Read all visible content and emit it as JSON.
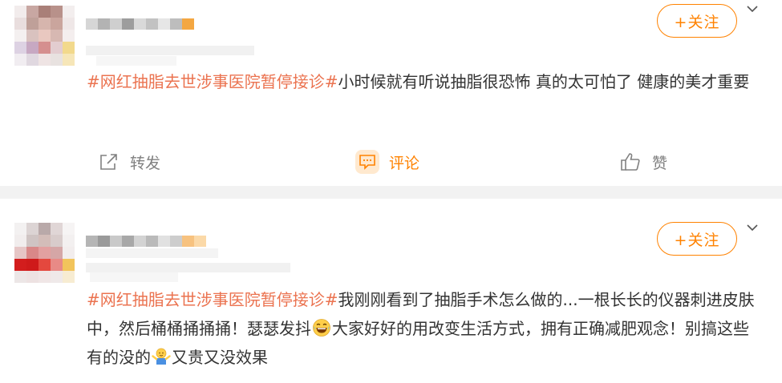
{
  "posts": [
    {
      "follow_label": "+关注",
      "topic": "#网红抽脂去世涉事医院暂停接诊#",
      "text": "小时候就有听说抽脂很恐怖 真的太可怕了 健康的美才重要",
      "actions": {
        "forward": "转发",
        "comment": "评论",
        "like": "赞"
      }
    },
    {
      "follow_label": "+关注",
      "topic": "#网红抽脂去世涉事医院暂停接诊#",
      "text_part1": "我刚刚看到了抽脂手术怎么做的...一根长长的仪器刺进皮肤中，然后桶桶捅捅捅！瑟瑟发抖",
      "text_part2": "大家好好的用改变生活方式，拥有正确减肥观念！别搞这些有的没的",
      "text_part3": "又贵又没效果"
    }
  ],
  "icons": {
    "forward": "share-icon",
    "comment": "comment-icon",
    "like": "thumbs-up-icon",
    "more": "chevron-down-icon",
    "emoji1": "laughing-tears-emoji",
    "emoji2": "shrug-emoji"
  },
  "colors": {
    "accent": "#ff8200",
    "topic": "#eb7350",
    "text": "#333333",
    "muted": "#808080",
    "separator": "#f2f2f2"
  }
}
